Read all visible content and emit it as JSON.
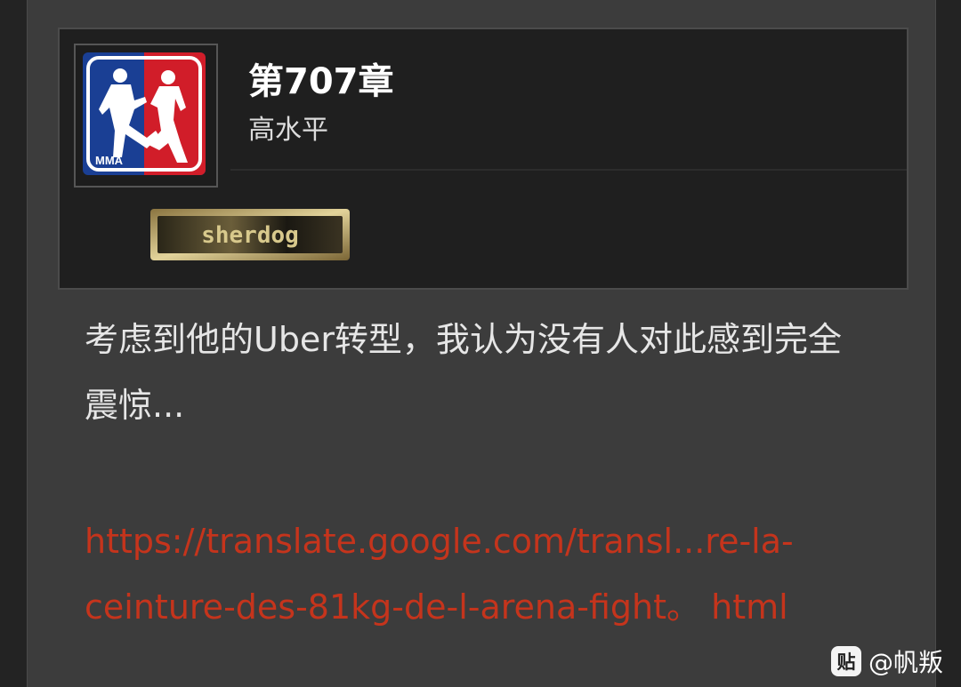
{
  "post": {
    "embed": {
      "title": "第707章",
      "author": "高水平",
      "thumbnail_badge": "MMA",
      "banner_text": "sherdog"
    },
    "body_text": "考虑到他的Uber转型，我认为没有人对此感到完全震惊...",
    "link_text": "https://translate.google.com/transl...re-la-ceinture-des-81kg-de-l-arena-fight。 html"
  },
  "watermark": {
    "icon_label": "贴",
    "handle": "@帆叛"
  },
  "colors": {
    "link": "#c5341c",
    "mma_blue": "#1a3f94",
    "mma_red": "#d11d29"
  }
}
